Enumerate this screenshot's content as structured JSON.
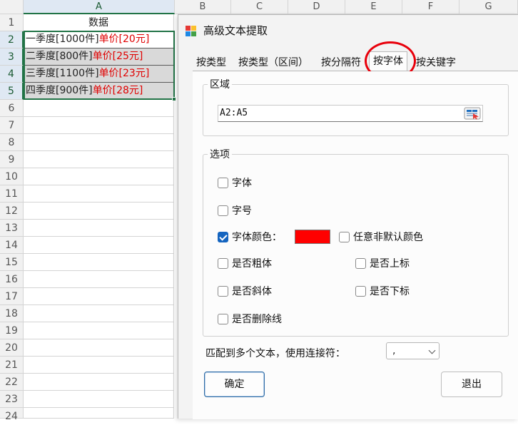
{
  "sheet": {
    "columns": [
      "A",
      "B",
      "C",
      "D",
      "E",
      "F",
      "G"
    ],
    "rows": [
      "1",
      "2",
      "3",
      "4",
      "5",
      "6",
      "7",
      "8",
      "9",
      "10",
      "11",
      "12",
      "13",
      "14",
      "15",
      "16",
      "17",
      "18",
      "19",
      "20",
      "21",
      "22",
      "23",
      "24"
    ],
    "header_cell": "数据",
    "data_rows": [
      {
        "black": "一季度[1000件]",
        "red": "单价[20元]"
      },
      {
        "black": "二季度[800件]",
        "red": "单价[25元]"
      },
      {
        "black": "三季度[1100件]",
        "red": "单价[23元]"
      },
      {
        "black": "四季度[900件]",
        "red": "单价[28元]"
      }
    ],
    "text_red_color": "#e00000",
    "selection_color": "#217346"
  },
  "dialog": {
    "title": "高级文本提取",
    "icon": "app-grid-icon",
    "tabs": [
      "按类型",
      "按类型（区间）",
      "按分隔符",
      "按字体",
      "按关键字"
    ],
    "active_tab": "按字体",
    "region_group": "区域",
    "range_value": "A2:A5",
    "range_button_icon": "range-select-icon",
    "options_group": "选项",
    "options": {
      "font": {
        "label": "字体",
        "checked": false
      },
      "size": {
        "label": "字号",
        "checked": false
      },
      "font_color": {
        "label": "字体颜色：",
        "checked": true,
        "color": "#ff0000"
      },
      "any_non_default": {
        "label": "任意非默认颜色",
        "checked": false
      },
      "bold": {
        "label": "是否粗体",
        "checked": false
      },
      "superscript": {
        "label": "是否上标",
        "checked": false
      },
      "italic": {
        "label": "是否斜体",
        "checked": false
      },
      "subscript": {
        "label": "是否下标",
        "checked": false
      },
      "strikethrough": {
        "label": "是否删除线",
        "checked": false
      }
    },
    "match_label": "匹配到多个文本，使用连接符：",
    "separator_value": ",",
    "ok_label": "确定",
    "exit_label": "退出",
    "highlight_color": "#e8000b"
  }
}
